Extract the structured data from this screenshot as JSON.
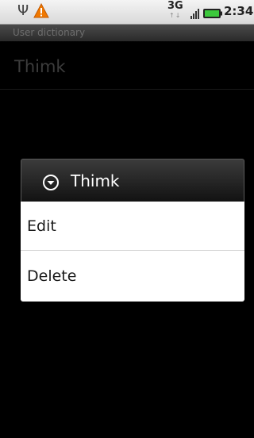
{
  "status_bar": {
    "usb_icon": "usb-icon",
    "warning_icon": "warning-icon",
    "network_type": "3G",
    "network_activity": "↑↓",
    "signal_icon": "signal-icon",
    "battery_icon": "battery-icon",
    "time": "2:34"
  },
  "title_bar": {
    "title": "User dictionary"
  },
  "word_list": [
    {
      "word": "Thimk"
    }
  ],
  "dialog": {
    "icon": "chevron-down-circle-icon",
    "title": "Thimk",
    "items": [
      {
        "label": "Edit"
      },
      {
        "label": "Delete"
      }
    ]
  },
  "colors": {
    "status_bar_bg": "#e4e4e4",
    "warning": "#f07800",
    "battery_fill": "#3cc83c",
    "dialog_header_bg": "#1f1f1f",
    "dialog_body_bg": "#ffffff"
  }
}
